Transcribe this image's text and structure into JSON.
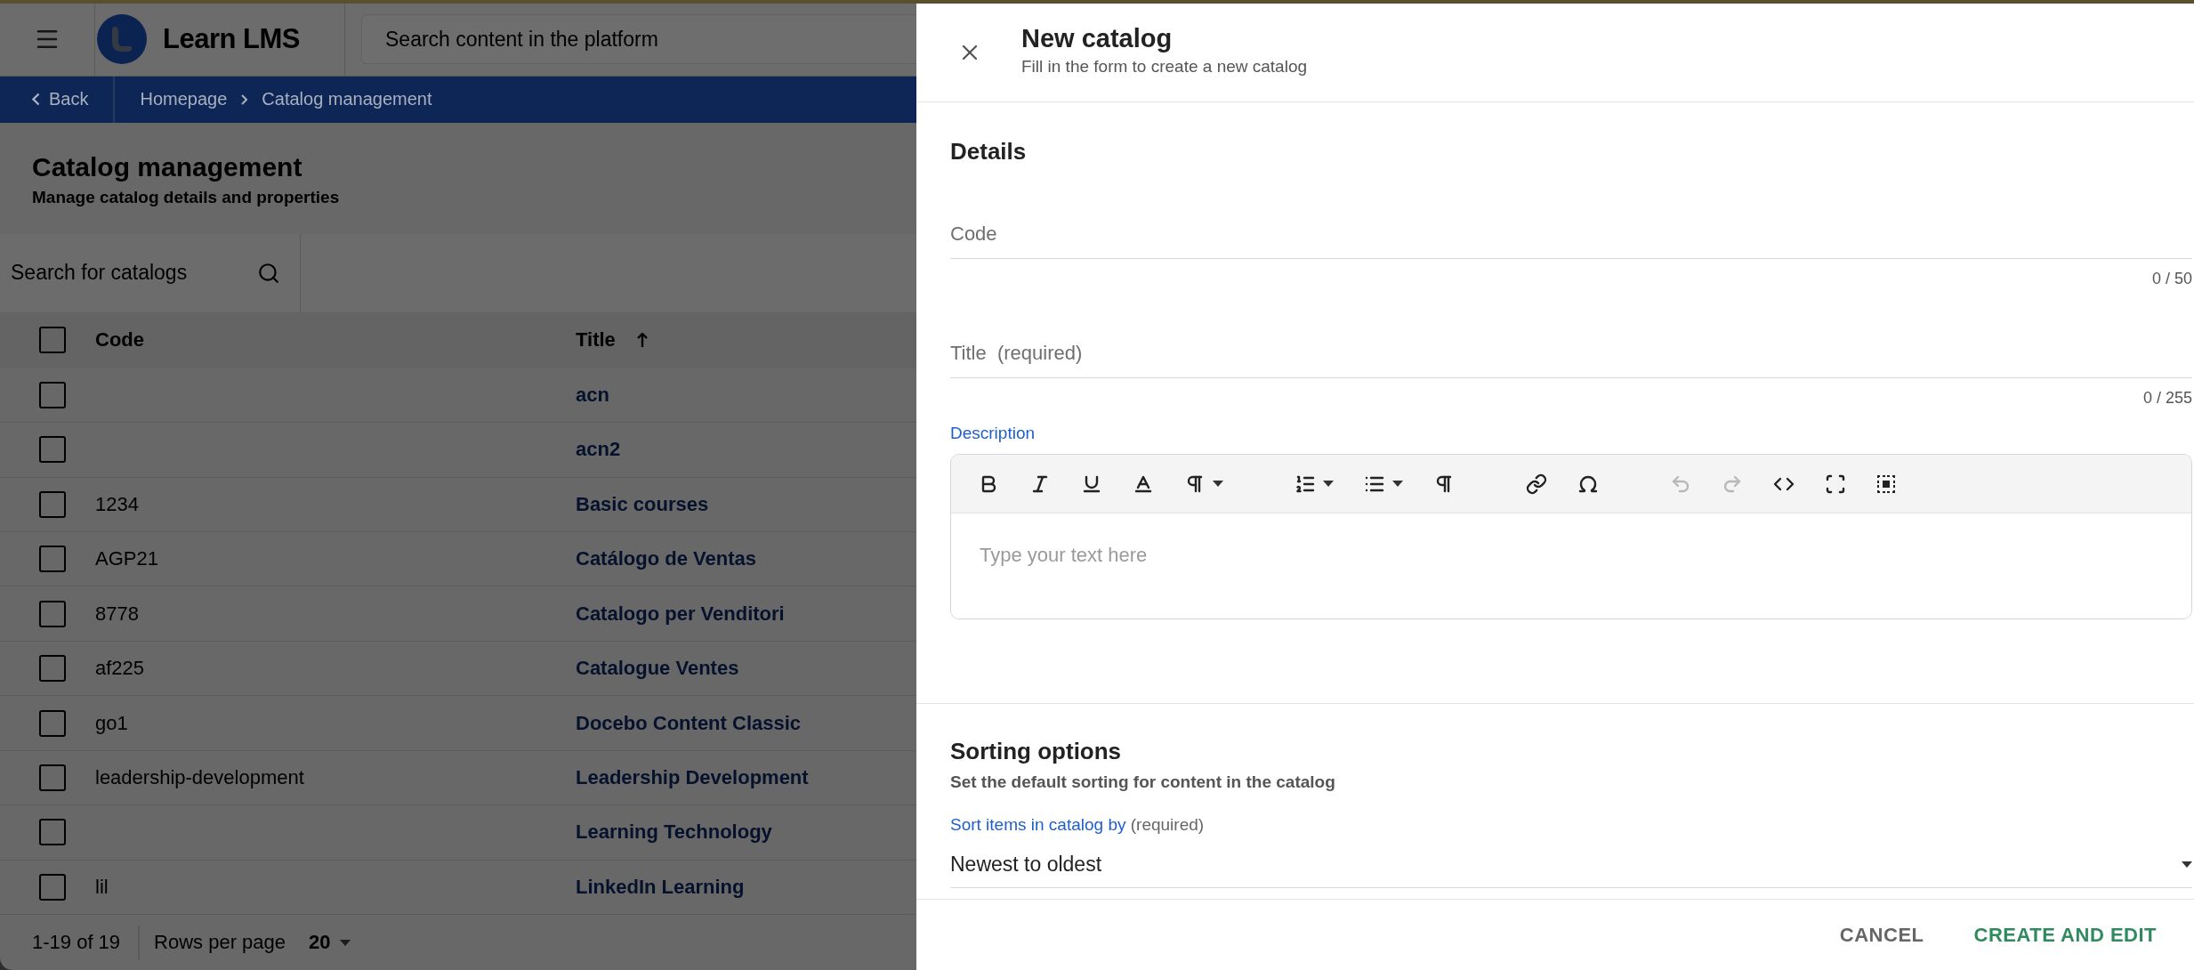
{
  "top_bar": {
    "brand": "Learn LMS",
    "search": {
      "placeholder": "Search content in the platform"
    }
  },
  "breadcrumb": {
    "back": "Back",
    "items": [
      "Homepage",
      "Catalog management"
    ]
  },
  "page": {
    "title": "Catalog management",
    "subtitle": "Manage catalog details and properties"
  },
  "table_search": {
    "placeholder": "Search for catalogs"
  },
  "table": {
    "select_all_checked": false,
    "columns": [
      {
        "label": "Code",
        "sorted": false
      },
      {
        "label": "Title",
        "sorted": true
      }
    ],
    "rows": [
      {
        "title": "acn",
        "checked": false
      },
      {
        "title": "acn2",
        "checked": false
      },
      {
        "code": "1234",
        "title": "Basic courses",
        "checked": false
      },
      {
        "code": "AGP21",
        "title": "Catálogo de Ventas",
        "checked": false
      },
      {
        "code": "8778",
        "title": "Catalogo per Venditori",
        "checked": false
      },
      {
        "code": "af225",
        "title": "Catalogue Ventes",
        "checked": false
      },
      {
        "code": "go1",
        "title": "Docebo Content Classic",
        "checked": false
      },
      {
        "code": "leadership-development",
        "title": "Leadership Development",
        "checked": false
      },
      {
        "title": "Learning Technology",
        "checked": false
      },
      {
        "code": "lil",
        "title": "LinkedIn Learning",
        "checked": false
      }
    ]
  },
  "pagination": {
    "range": "1-19 of 19",
    "rows_per_page_label": "Rows per page",
    "rows_per_page": "20"
  },
  "drawer": {
    "title": "New catalog",
    "subtitle": "Fill in the form to create a new catalog",
    "details": {
      "heading": "Details",
      "fields": [
        {
          "placeholder": "Code",
          "counter": "0 / 50"
        },
        {
          "placeholder": "Title  (required)",
          "counter": "0 / 255"
        }
      ]
    },
    "description": {
      "label": "Description",
      "placeholder": "Type your text here",
      "toolbar": [
        [
          {
            "kind": "bold",
            "disabled": false,
            "dropdown": false
          },
          {
            "kind": "italic",
            "disabled": false,
            "dropdown": false
          },
          {
            "kind": "underline",
            "disabled": false,
            "dropdown": false
          },
          {
            "kind": "text-color",
            "disabled": false,
            "dropdown": false
          },
          {
            "kind": "paragraph",
            "disabled": false,
            "dropdown": true
          }
        ],
        [
          {
            "kind": "numbered-list",
            "disabled": false,
            "dropdown": true
          },
          {
            "kind": "bullet-list",
            "disabled": false,
            "dropdown": true
          },
          {
            "kind": "paragraph-format",
            "disabled": false,
            "dropdown": false
          }
        ],
        [
          {
            "kind": "link",
            "disabled": false,
            "dropdown": false
          },
          {
            "kind": "special-character",
            "disabled": false,
            "dropdown": false
          }
        ],
        [
          {
            "kind": "undo",
            "disabled": true,
            "dropdown": false
          },
          {
            "kind": "redo",
            "disabled": true,
            "dropdown": false
          },
          {
            "kind": "code",
            "disabled": false,
            "dropdown": false
          },
          {
            "kind": "fullscreen",
            "disabled": false,
            "dropdown": false
          },
          {
            "kind": "select-all",
            "disabled": false,
            "dropdown": false
          }
        ]
      ]
    },
    "sorting": {
      "heading": "Sorting options",
      "subtitle": "Set the default sorting for content in the catalog",
      "select": {
        "label": "Sort items in catalog by",
        "hint": "(required)",
        "value": "Newest to oldest"
      }
    },
    "actions": [
      {
        "label": "CANCEL",
        "kind": "secondary"
      },
      {
        "label": "CREATE AND EDIT",
        "kind": "primary"
      }
    ]
  }
}
